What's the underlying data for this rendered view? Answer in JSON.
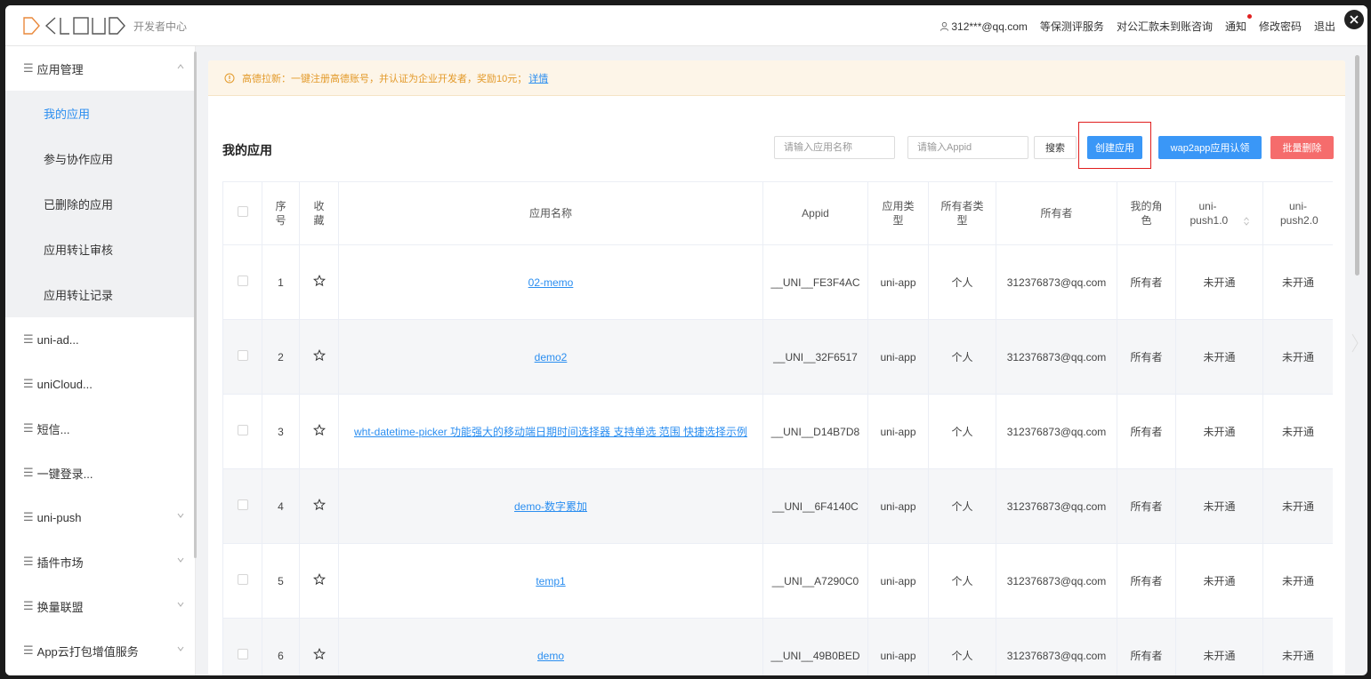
{
  "header": {
    "logo_text": "DCLOUD",
    "logo_sub": "开发者中心",
    "user": "312***@qq.com",
    "links": [
      "等保测评服务",
      "对公汇款未到账咨询",
      "通知",
      "修改密码",
      "退出"
    ]
  },
  "sidebar": {
    "app_mgmt": "应用管理",
    "sub_items": [
      "我的应用",
      "参与协作应用",
      "已删除的应用",
      "应用转让审核",
      "应用转让记录"
    ],
    "groups": [
      "uni-ad...",
      "uniCloud...",
      "短信...",
      "一键登录...",
      "uni-push",
      "插件市场",
      "换量联盟",
      "App云打包增值服务"
    ]
  },
  "notice": {
    "text": "高德拉新：一键注册高德账号，并认证为企业开发者，奖励10元；",
    "link": "详情"
  },
  "toolbar": {
    "title": "我的应用",
    "name_placeholder": "请输入应用名称",
    "appid_placeholder": "请输入Appid",
    "search": "搜索",
    "create": "创建应用",
    "wap2app": "wap2app应用认领",
    "batch_delete": "批量删除"
  },
  "table": {
    "headers": {
      "index": "序号",
      "fav": "收藏",
      "name": "应用名称",
      "appid": "Appid",
      "type": "应用类型",
      "owner_type": "所有者类型",
      "owner": "所有者",
      "role": "我的角色",
      "push1": "uni-push1.0",
      "push2": "uni-push2.0"
    },
    "rows": [
      {
        "index": "1",
        "name": "02-memo",
        "appid": "__UNI__FE3F4AC",
        "type": "uni-app",
        "owner_type": "个人",
        "owner": "312376873@qq.com",
        "role": "所有者",
        "push1": "未开通",
        "push2": "未开通"
      },
      {
        "index": "2",
        "name": "demo2",
        "appid": "__UNI__32F6517",
        "type": "uni-app",
        "owner_type": "个人",
        "owner": "312376873@qq.com",
        "role": "所有者",
        "push1": "未开通",
        "push2": "未开通"
      },
      {
        "index": "3",
        "name": "wht-datetime-picker 功能强大的移动端日期时间选择器 支持单选 范围 快捷选择示例",
        "appid": "__UNI__D14B7D8",
        "type": "uni-app",
        "owner_type": "个人",
        "owner": "312376873@qq.com",
        "role": "所有者",
        "push1": "未开通",
        "push2": "未开通"
      },
      {
        "index": "4",
        "name": "demo-数字累加",
        "appid": "__UNI__6F4140C",
        "type": "uni-app",
        "owner_type": "个人",
        "owner": "312376873@qq.com",
        "role": "所有者",
        "push1": "未开通",
        "push2": "未开通"
      },
      {
        "index": "5",
        "name": "temp1",
        "appid": "__UNI__A7290C0",
        "type": "uni-app",
        "owner_type": "个人",
        "owner": "312376873@qq.com",
        "role": "所有者",
        "push1": "未开通",
        "push2": "未开通"
      },
      {
        "index": "6",
        "name": "demo",
        "appid": "__UNI__49B0BED",
        "type": "uni-app",
        "owner_type": "个人",
        "owner": "312376873@qq.com",
        "role": "所有者",
        "push1": "未开通",
        "push2": "未开通"
      }
    ]
  },
  "colors": {
    "accent": "#2b8ef0",
    "danger": "#f56c6c",
    "notice_text": "#e39a2a"
  }
}
